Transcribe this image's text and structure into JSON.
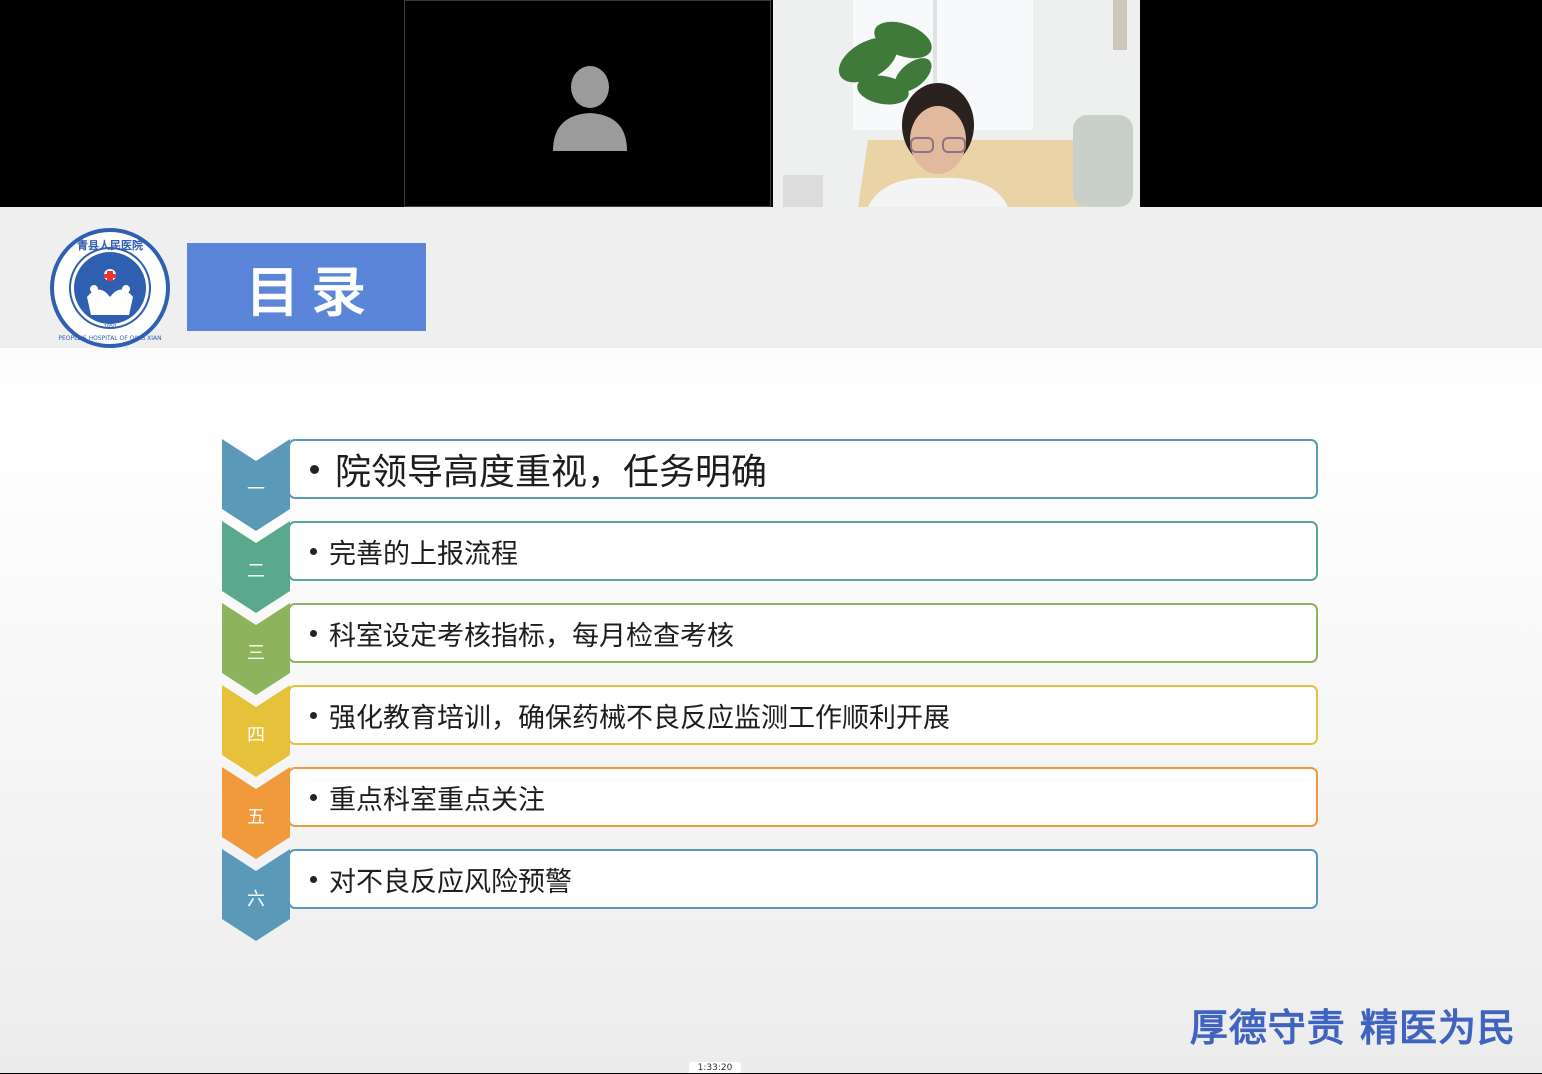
{
  "slide": {
    "title": "目录",
    "agenda_items": [
      {
        "index": "一",
        "text": "院领导高度重视，任务明确",
        "color": "#5a9ab8"
      },
      {
        "index": "二",
        "text": "完善的上报流程",
        "color": "#5aa98f"
      },
      {
        "index": "三",
        "text": "科室设定考核指标，每月检查考核",
        "color": "#8db35c"
      },
      {
        "index": "四",
        "text": "强化教育培训，确保药械不良反应监测工作顺利开展",
        "color": "#e5c23a"
      },
      {
        "index": "五",
        "text": "重点科室重点关注",
        "color": "#f09a3c"
      },
      {
        "index": "六",
        "text": "对不良反应风险预警",
        "color": "#5a9ab8"
      }
    ],
    "slogan": "厚德守责   精医为民",
    "logo": {
      "text_top": "青县人民医院",
      "text_bottom": "PEOPLE'S HOSPITAL OF QING XIAN",
      "year": "1950",
      "color": "#2f5fb0"
    }
  },
  "video": {
    "participants": [
      {
        "name": "avatar-placeholder",
        "state": "camera-off"
      },
      {
        "name": "presenter-camera",
        "state": "camera-on"
      }
    ]
  },
  "player": {
    "timestamp": "1:33:20"
  }
}
